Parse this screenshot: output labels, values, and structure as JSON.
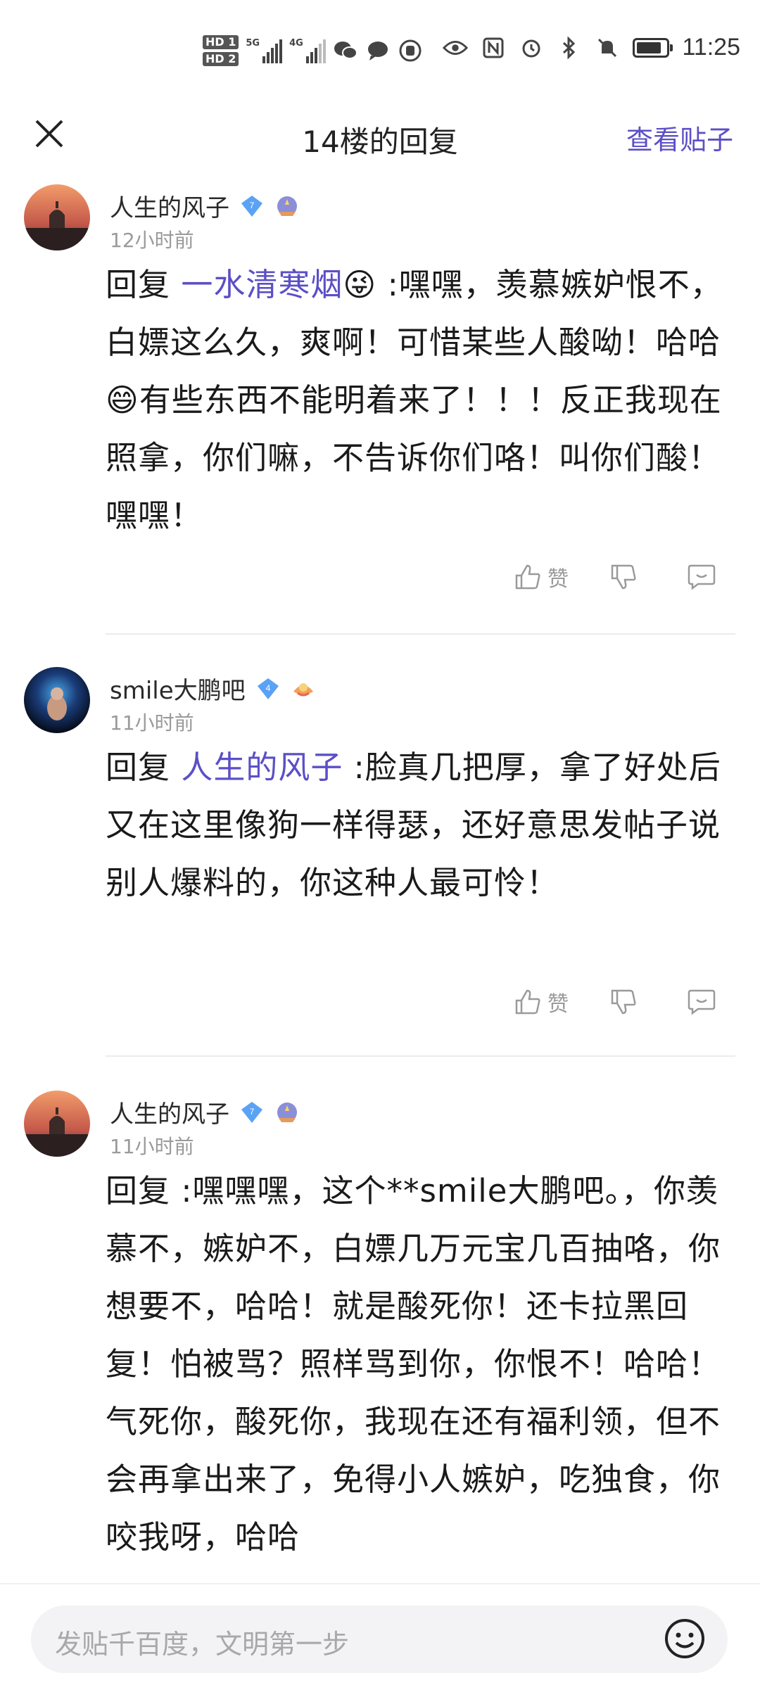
{
  "status_bar": {
    "hd1": "HD 1",
    "hd2": "HD 2",
    "net1": "5G",
    "net2": "4G",
    "time": "11:25",
    "battery_level": 0.85,
    "icons": [
      "wechat-icon",
      "message-icon",
      "hand-icon",
      "shield-icon",
      "eye-icon",
      "nfc-icon",
      "alarm-icon",
      "bluetooth-icon",
      "mute-icon",
      "battery-icon"
    ]
  },
  "header": {
    "title": "14楼的回复",
    "view_post": "查看贴子"
  },
  "posts": [
    {
      "username": "人生的风子",
      "level": "7",
      "time": "12小时前",
      "reply_prefix": "回复",
      "mention": "一水清寒烟",
      "text": " :嘿嘿，羡慕嫉妒恨不，白嫖这么久，爽啊！可惜某些人酸呦！哈哈😄有些东西不能明着来了！！！反正我现在照拿，你们嘛，不告诉你们咯！叫你们酸！嘿嘿！",
      "like_label": "赞"
    },
    {
      "username": "smile大鹏吧",
      "level": "4",
      "time": "11小时前",
      "reply_prefix": "回复",
      "mention": "人生的风子",
      "text": " :脸真几把厚，拿了好处后又在这里像狗一样得瑟，还好意思发帖子说别人爆料的，你这种人最可怜！",
      "like_label": "赞"
    },
    {
      "username": "人生的风子",
      "level": "7",
      "time": "11小时前",
      "reply_prefix": "回复",
      "mention": "",
      "text": " :嘿嘿嘿，这个**smile大鹏吧。，你羡慕不，嫉妒不，白嫖几万元宝几百抽咯，你想要不，哈哈！就是酸死你！还卡拉黑回复！怕被骂？照样骂到你，你恨不！哈哈！气死你，酸死你，我现在还有福利领，但不会再拿出来了，免得小人嫉妒，吃独食，你咬我呀，哈哈",
      "like_label": ""
    }
  ],
  "input": {
    "placeholder": "发贴千百度，文明第一步"
  },
  "colors": {
    "accent": "#5b4fc7",
    "badge_blue": "#4a8df0"
  }
}
